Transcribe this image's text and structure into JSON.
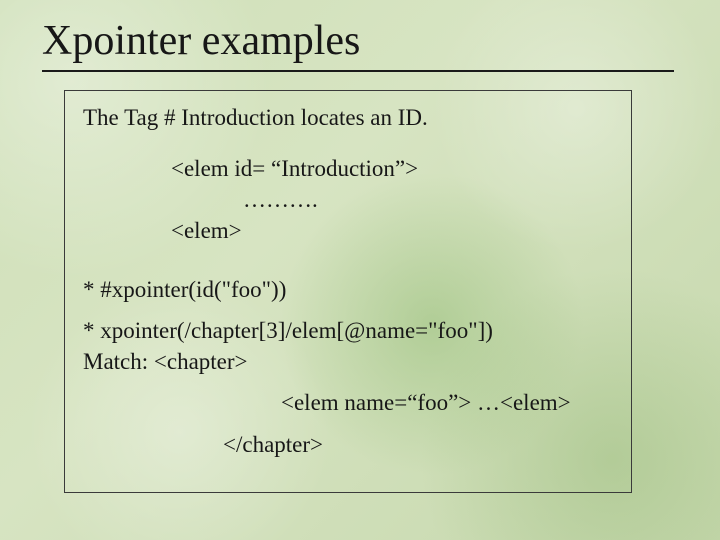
{
  "title": "Xpointer examples",
  "lead": "The Tag # Introduction  locates an ID.",
  "code": {
    "l1": "<elem id= “Introduction”>",
    "l2": "……….",
    "l3": "<elem>"
  },
  "bullet1": "* #xpointer(id(\"foo\"))",
  "bullet2_line1": "* xpointer(/chapter[3]/elem[@name=\"foo\"])",
  "bullet2_line2": "Match:    <chapter>",
  "example_line": "<elem name=“foo”> …<elem>",
  "close_line": "</chapter>"
}
